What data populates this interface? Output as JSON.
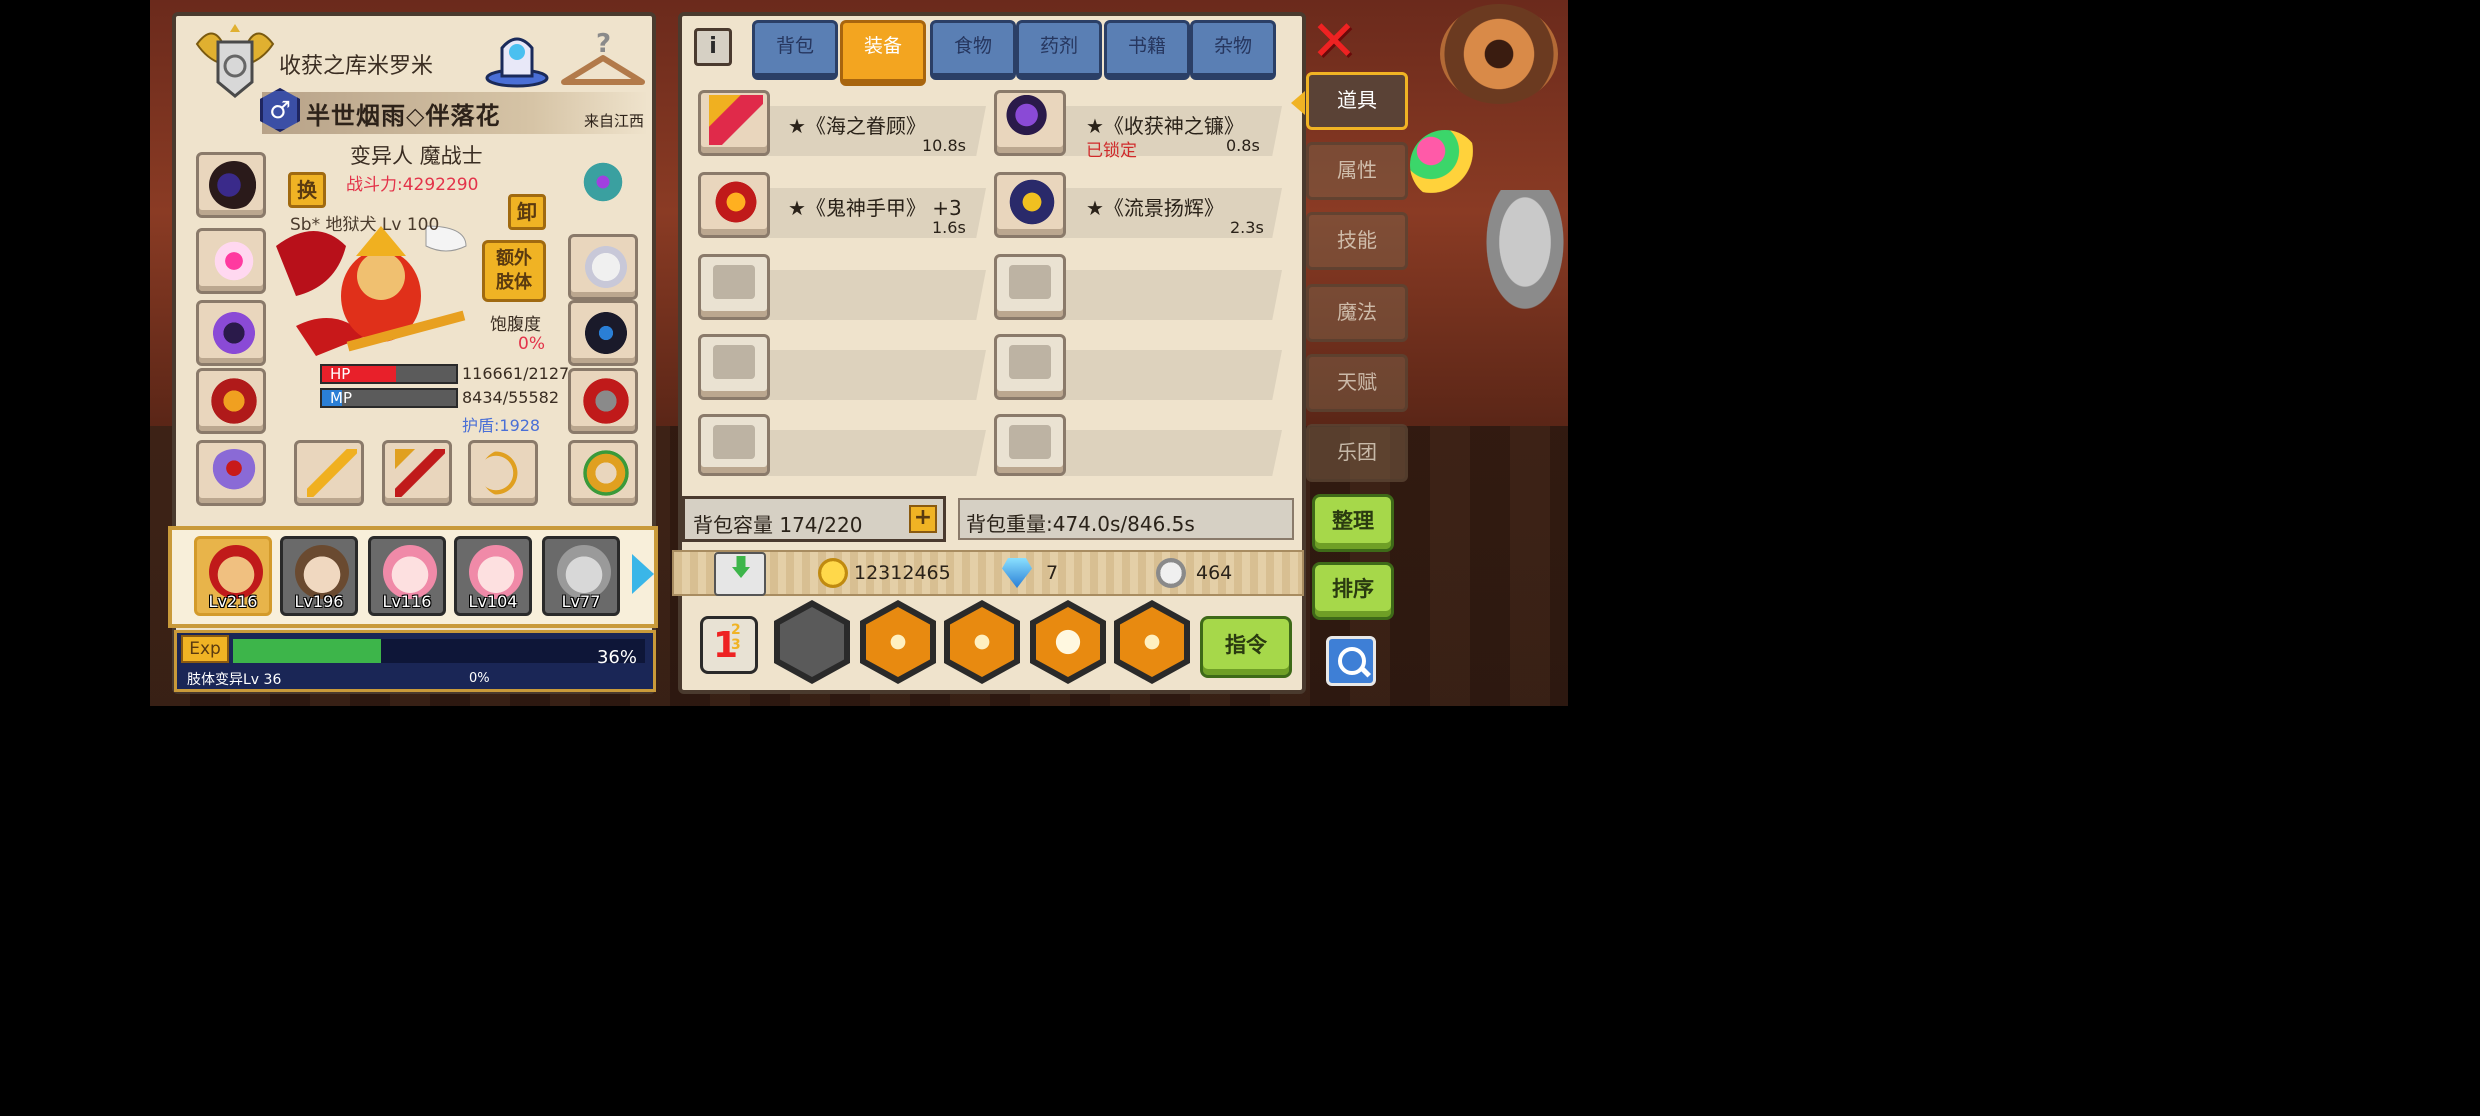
{
  "character": {
    "name": "收获之库米罗米",
    "gender_symbol": "♂",
    "title": "半世烟雨◇伴落花",
    "origin": "来自江西",
    "class": "变异人 魔战士",
    "power": "战斗力:4292290",
    "pet_label": "Sb* 地狱犬  Lv 100",
    "swap_label": "换",
    "unequip_label": "卸",
    "extra_limb_label": "额外\n肢体",
    "satiety_label": "饱腹度",
    "satiety_value": "0%",
    "hp_label": "HP",
    "hp_value": "116661/2127",
    "hp_fill": 0.55,
    "mp_label": "MP",
    "mp_value": "8434/55582",
    "mp_fill": 0.15,
    "shield": "护盾:1928",
    "accent_hp": "#e8202a",
    "accent_mp": "#2a7fd6"
  },
  "party": {
    "members": [
      {
        "level": "Lv216",
        "active": true
      },
      {
        "level": "Lv196",
        "active": false
      },
      {
        "level": "Lv116",
        "active": false
      },
      {
        "level": "Lv104",
        "active": false
      },
      {
        "level": "Lv77",
        "active": false
      }
    ]
  },
  "exp": {
    "label": "Exp",
    "fill": 0.36,
    "percent": "36%",
    "mutation": "肢体变异Lv 36",
    "mutation_percent": "0%"
  },
  "inventory": {
    "tabs": [
      "背包",
      "装备",
      "食物",
      "药剂",
      "书籍",
      "杂物"
    ],
    "active_tab": "装备",
    "items": [
      {
        "name": "★《海之眷顾》",
        "time": "10.8s",
        "icon": "red-crossbow-icon"
      },
      {
        "name": "★《收获神之镰》",
        "time": "0.8s",
        "locked": "已锁定",
        "icon": "purple-scythe-icon"
      },
      {
        "name": "★《鬼神手甲》 +3",
        "time": "1.6s",
        "icon": "fire-gauntlet-icon"
      },
      {
        "name": "★《流景扬辉》",
        "time": "2.3s",
        "icon": "golden-crest-icon"
      }
    ],
    "capacity": "背包容量 174/220",
    "weight": "背包重量:474.0s/846.5s"
  },
  "currency": {
    "gold": "12312465",
    "diamond": "7",
    "silver": "464"
  },
  "buttons": {
    "command": "指令",
    "tidy": "整理",
    "sort": "排序"
  },
  "side_tabs": [
    "道具",
    "属性",
    "技能",
    "魔法",
    "天赋",
    "乐团"
  ],
  "side_active": "道具"
}
